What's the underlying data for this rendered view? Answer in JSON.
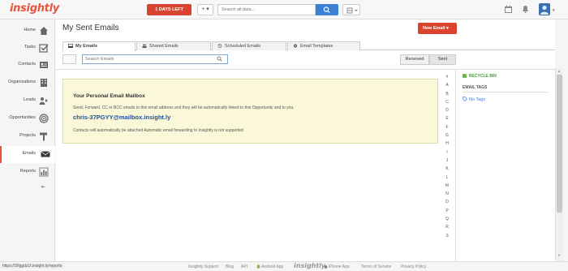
{
  "header": {
    "logo": "insightly",
    "days_left": "1 DAYS LEFT",
    "add_label": "+ ▾",
    "search_placeholder": "Search all data...",
    "grid_label": "▦ ▾"
  },
  "sidebar": {
    "items": [
      {
        "label": "Home",
        "icon": "house-icon"
      },
      {
        "label": "Tasks",
        "icon": "checkbox-icon"
      },
      {
        "label": "Contacts",
        "icon": "contact-card-icon"
      },
      {
        "label": "Organizations",
        "icon": "building-icon"
      },
      {
        "label": "Leads",
        "icon": "leads-icon"
      },
      {
        "label": "Opportunities",
        "icon": "target-icon"
      },
      {
        "label": "Projects",
        "icon": "hammer-icon"
      },
      {
        "label": "Emails",
        "icon": "envelope-icon"
      },
      {
        "label": "Reports",
        "icon": "bar-chart-icon"
      }
    ],
    "active": "Emails",
    "collapse_label": "⇤"
  },
  "main": {
    "title": "My Sent Emails",
    "new_email_label": "New Email  ▾",
    "tabs": [
      {
        "label": "My Emails",
        "active": true
      },
      {
        "label": "Shared Emails",
        "active": false
      },
      {
        "label": "Scheduled Emails",
        "active": false
      },
      {
        "label": "Email Templates",
        "active": false
      }
    ],
    "search_placeholder": "Search Emails",
    "received_label": "Received",
    "sent_label": "Sent",
    "mailbox": {
      "title": "Your Personal Email Mailbox",
      "text": "Send, Forward, CC or BCC emails to this email address and they will be automatically linked to this Opportunity and to you.",
      "email": "chris-37PGYY@mailbox.insight.ly",
      "note": "Contacts will automatically be attached Automatic email forwarding to Insightly is not supported"
    },
    "alpha_index": [
      "#",
      "A",
      "B",
      "C",
      "D",
      "E",
      "F",
      "G",
      "H",
      "I",
      "J",
      "K",
      "L",
      "M",
      "N",
      "O",
      "P",
      "Q",
      "R",
      "S"
    ]
  },
  "right_panel": {
    "recycle_bin": "RECYCLE BIN",
    "email_tags": "EMAIL TAGS",
    "no_tags": "No Tags"
  },
  "footer": {
    "status_url": "https://30ggdz1f.insight.ly/reports",
    "links": [
      "Insightly Support",
      "Blog",
      "API",
      "Android App",
      "iPhone App",
      "Terms of Service",
      "Privacy Policy"
    ],
    "logo": "insightly"
  },
  "colors": {
    "brand_red": "#d9432f",
    "logo_orange": "#e8543a",
    "link_blue": "#3b82d6",
    "mailbox_bg": "#fbf8d9",
    "recycle_green": "#4a9a3a"
  }
}
